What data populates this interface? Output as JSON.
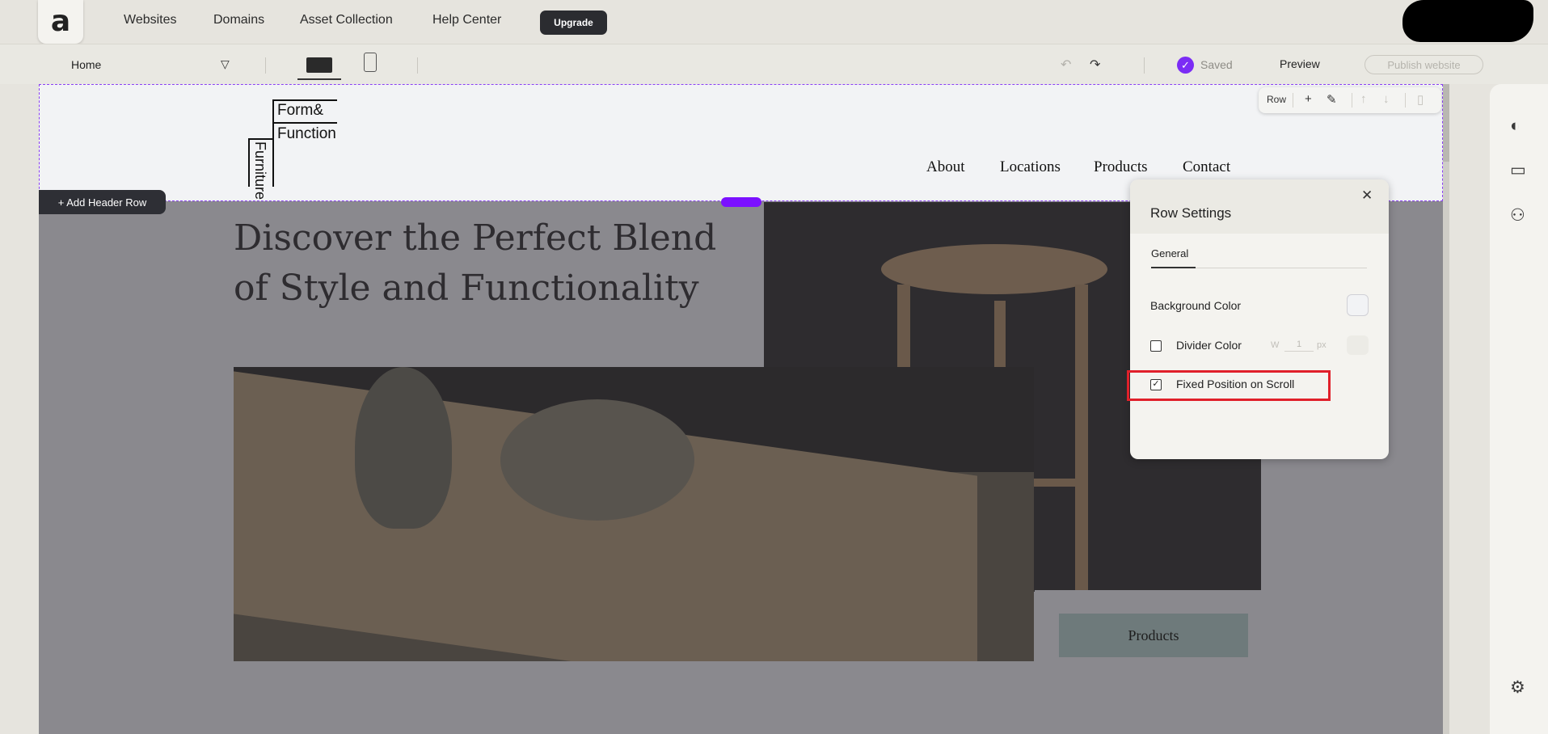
{
  "topnav": {
    "logo": "a",
    "links": [
      "Websites",
      "Domains",
      "Asset Collection",
      "Help Center"
    ],
    "upgrade_label": "Upgrade"
  },
  "toolbar": {
    "page": "Home",
    "saved_label": "Saved",
    "preview_label": "Preview",
    "publish_label": "Publish website"
  },
  "header": {
    "brand_line1": "Form&",
    "brand_line2": "Function",
    "brand_vertical": "Furniture",
    "nav": [
      "About",
      "Locations",
      "Products",
      "Contact"
    ],
    "row_tools_label": "Row",
    "add_header_row_label": "+ Add Header Row"
  },
  "hero": {
    "headline": "Discover the Perfect Blend of Style and Functionality",
    "cta_label": "Products"
  },
  "row_settings": {
    "title": "Row Settings",
    "tab": "General",
    "background_color_label": "Background Color",
    "divider_color_label": "Divider Color",
    "divider_width_label": "W",
    "divider_width_value": "1",
    "divider_unit": "px",
    "fixed_position_label": "Fixed Position on Scroll",
    "fixed_position_checked": true,
    "divider_checked": false
  },
  "colors": {
    "accent": "#7b2cf5",
    "highlight": "#e0202a"
  }
}
